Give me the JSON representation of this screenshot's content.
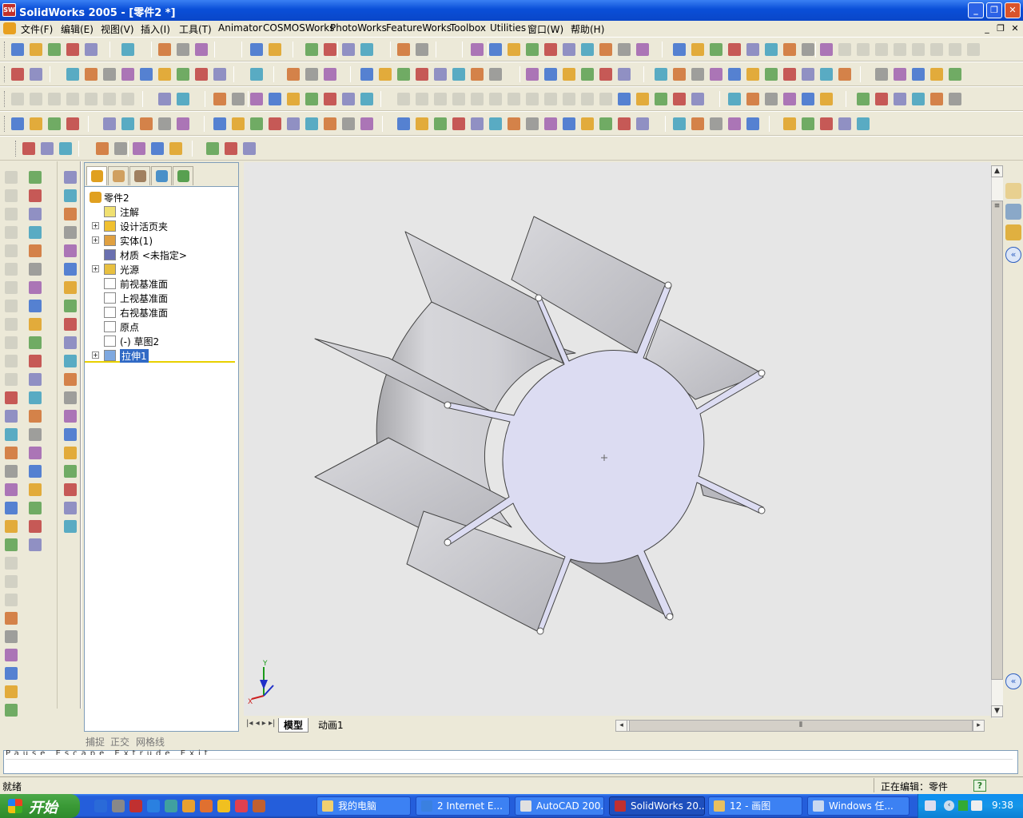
{
  "window": {
    "title": "SolidWorks 2005 - [零件2 *]",
    "logo": "SW"
  },
  "menu": {
    "items": [
      "文件(F)",
      "编辑(E)",
      "视图(V)",
      "插入(I)",
      "工具(T)",
      "Animator",
      "COSMOSWorks",
      "PhotoWorks",
      "FeatureWorks",
      "Toolbox",
      "Utilities",
      "窗口(W)",
      "帮助(H)"
    ]
  },
  "tree": {
    "root": "零件2",
    "items": [
      {
        "label": "注解",
        "expandable": false,
        "icon": "annotation-icon"
      },
      {
        "label": "设计活页夹",
        "expandable": true,
        "icon": "design-binder-icon"
      },
      {
        "label": "实体(1)",
        "expandable": true,
        "icon": "solid-bodies-icon"
      },
      {
        "label": "材质 <未指定>",
        "expandable": false,
        "icon": "material-icon"
      },
      {
        "label": "光源",
        "expandable": true,
        "icon": "lights-icon"
      },
      {
        "label": "前视基准面",
        "expandable": false,
        "icon": "plane-icon"
      },
      {
        "label": "上视基准面",
        "expandable": false,
        "icon": "plane-icon"
      },
      {
        "label": "右视基准面",
        "expandable": false,
        "icon": "plane-icon"
      },
      {
        "label": "原点",
        "expandable": false,
        "icon": "origin-icon"
      },
      {
        "label": "(-) 草图2",
        "expandable": false,
        "icon": "sketch-icon"
      },
      {
        "label": "拉伸1",
        "expandable": true,
        "icon": "extrude-icon",
        "selected": true
      }
    ]
  },
  "viewport": {
    "triad": {
      "x": "X",
      "y": "Y"
    }
  },
  "bottom_tabs": [
    "模型",
    "动画1"
  ],
  "snapbar": {
    "snap": "捕捉",
    "ortho": "正交",
    "grid": "网格线"
  },
  "command_text": "Pause Escape Extrude Exit",
  "status": {
    "left": "就绪",
    "right": "正在编辑：零件",
    "help": "?"
  },
  "taskbar": {
    "start": "开始",
    "buttons": [
      "我的电脑",
      "2 Internet E...",
      "AutoCAD 200...",
      "SolidWorks 20...",
      "12 - 画图",
      "Windows 任..."
    ],
    "active_index": 3,
    "time": "9:38"
  },
  "colors": {
    "titlebar": "#0a4fd8",
    "taskbar": "#245edb",
    "viewport": "#e6e6e6",
    "part_face": "#dcdcf2",
    "part_side": "#c8c8c8"
  }
}
